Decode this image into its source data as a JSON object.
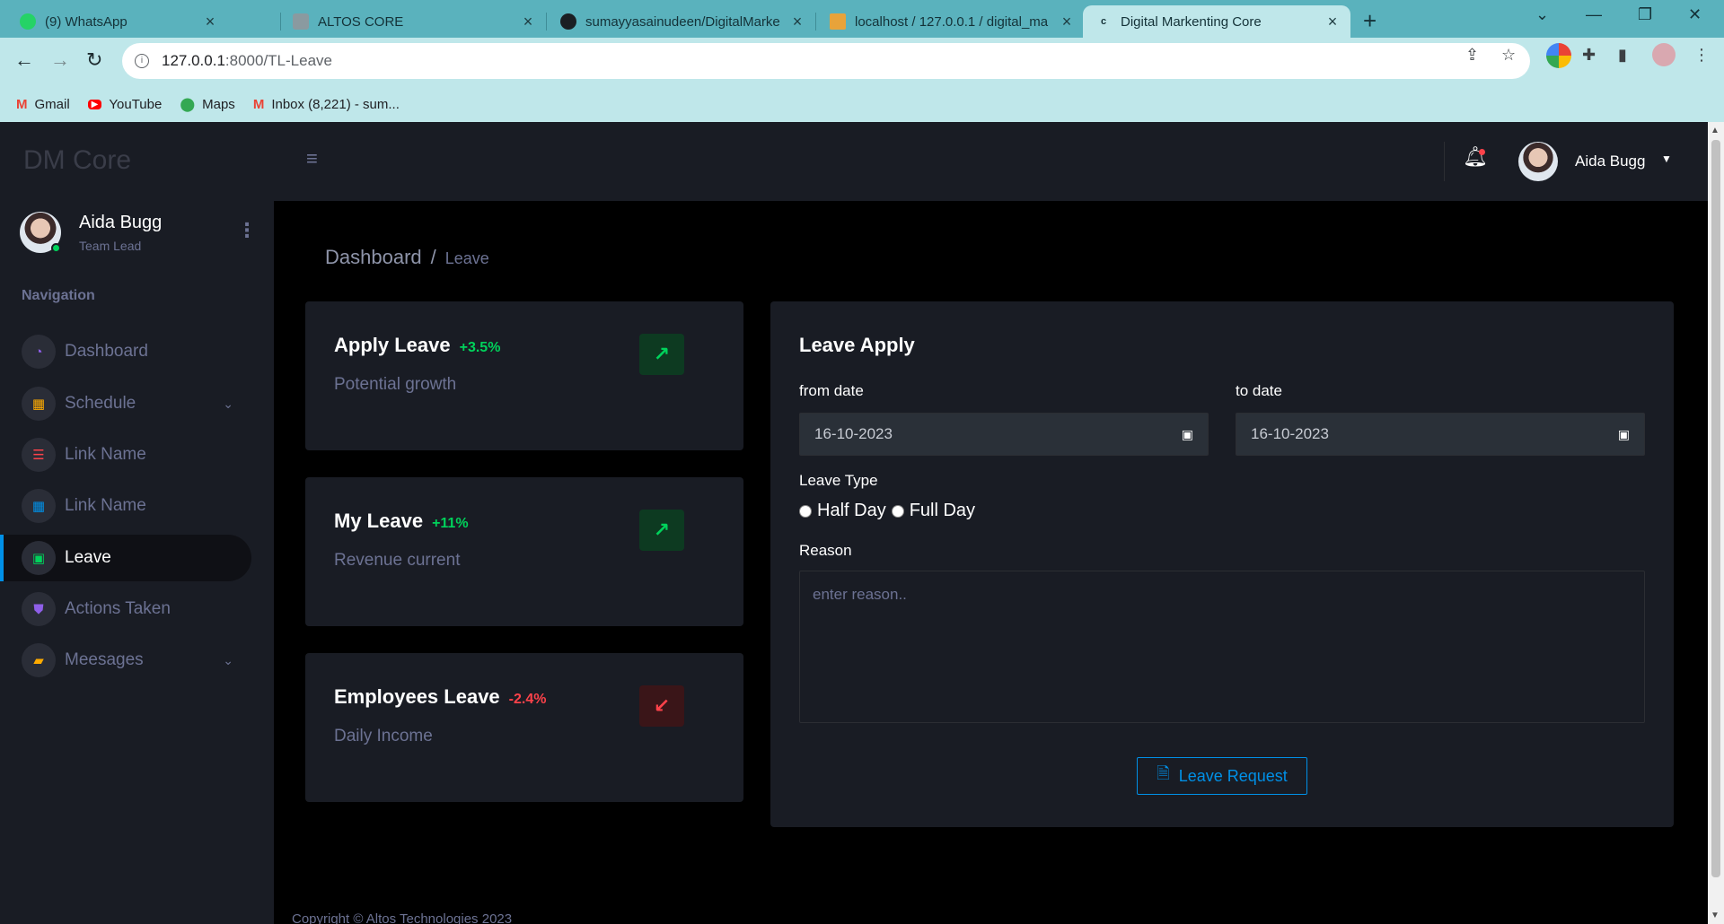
{
  "browser": {
    "tabs": [
      {
        "label": "(9) WhatsApp",
        "favicon_color": "#25d366"
      },
      {
        "label": "ALTOS CORE",
        "favicon_color": "#8a9aa0"
      },
      {
        "label": "sumayyasainudeen/DigitalMarke",
        "favicon_color": "#1b1f23"
      },
      {
        "label": "localhost / 127.0.0.1 / digital_ma",
        "favicon_color": "#e8a33a"
      },
      {
        "label": "Digital Markenting Core",
        "favicon_color": "#bfe7ea"
      }
    ],
    "new_tab": "+",
    "window_controls": {
      "minimize": "—",
      "restore": "❐",
      "close": "✕",
      "tab_search": "⌄"
    },
    "url_host": "127.0.0.1",
    "url_path": ":8000/TL-Leave",
    "bookmarks": [
      {
        "label": "Gmail",
        "icon": "gmail-icon"
      },
      {
        "label": "YouTube",
        "icon": "youtube-icon"
      },
      {
        "label": "Maps",
        "icon": "maps-icon"
      },
      {
        "label": "Inbox (8,221) - sum...",
        "icon": "gmail-icon"
      }
    ]
  },
  "sidebar": {
    "brand": "DM Core",
    "user_name": "Aida Bugg",
    "user_role": "Team Lead",
    "nav_title": "Navigation",
    "items": [
      {
        "label": "Dashboard",
        "icon": "speedometer-icon",
        "icon_color": "#8f5fe8"
      },
      {
        "label": "Schedule",
        "icon": "calendar-icon",
        "icon_color": "#ffab00",
        "has_children": true
      },
      {
        "label": "Link Name",
        "icon": "list-icon",
        "icon_color": "#fc424a"
      },
      {
        "label": "Link Name",
        "icon": "table-icon",
        "icon_color": "#0090e7"
      },
      {
        "label": "Leave",
        "icon": "calendar-check-icon",
        "icon_color": "#00d25b",
        "active": true
      },
      {
        "label": "Actions Taken",
        "icon": "shield-check-icon",
        "icon_color": "#8f5fe8"
      },
      {
        "label": "Meesages",
        "icon": "message-icon",
        "icon_color": "#ffab00",
        "has_children": true
      }
    ]
  },
  "topbar": {
    "user_name": "Aida Bugg",
    "has_notification": true
  },
  "breadcrumb": {
    "root": "Dashboard",
    "separator": "/",
    "current": "Leave"
  },
  "stats": [
    {
      "title": "Apply Leave",
      "delta": "+3.5%",
      "subtitle": "Potential growth",
      "trend": "up",
      "icon": "arrow-top-right-icon"
    },
    {
      "title": "My Leave",
      "delta": "+11%",
      "subtitle": "Revenue current",
      "trend": "up",
      "icon": "arrow-top-right-icon"
    },
    {
      "title": "Employees Leave",
      "delta": "-2.4%",
      "subtitle": "Daily Income",
      "trend": "down",
      "icon": "arrow-bottom-left-icon"
    }
  ],
  "leave_form": {
    "title": "Leave Apply",
    "from_label": "from date",
    "from_value": "16-10-2023",
    "to_label": "to date",
    "to_value": "16-10-2023",
    "type_label": "Leave Type",
    "type_options": [
      "Half Day",
      "Full Day"
    ],
    "reason_label": "Reason",
    "reason_placeholder": "enter reason..",
    "submit_label": "Leave Request"
  },
  "footer": "Copyright © Altos Technologies 2023",
  "colors": {
    "primary": "#0090e7",
    "success": "#00d25b",
    "danger": "#fc424a",
    "sidebar_bg": "#191c24",
    "chrome_tab": "#5ab2bd"
  }
}
